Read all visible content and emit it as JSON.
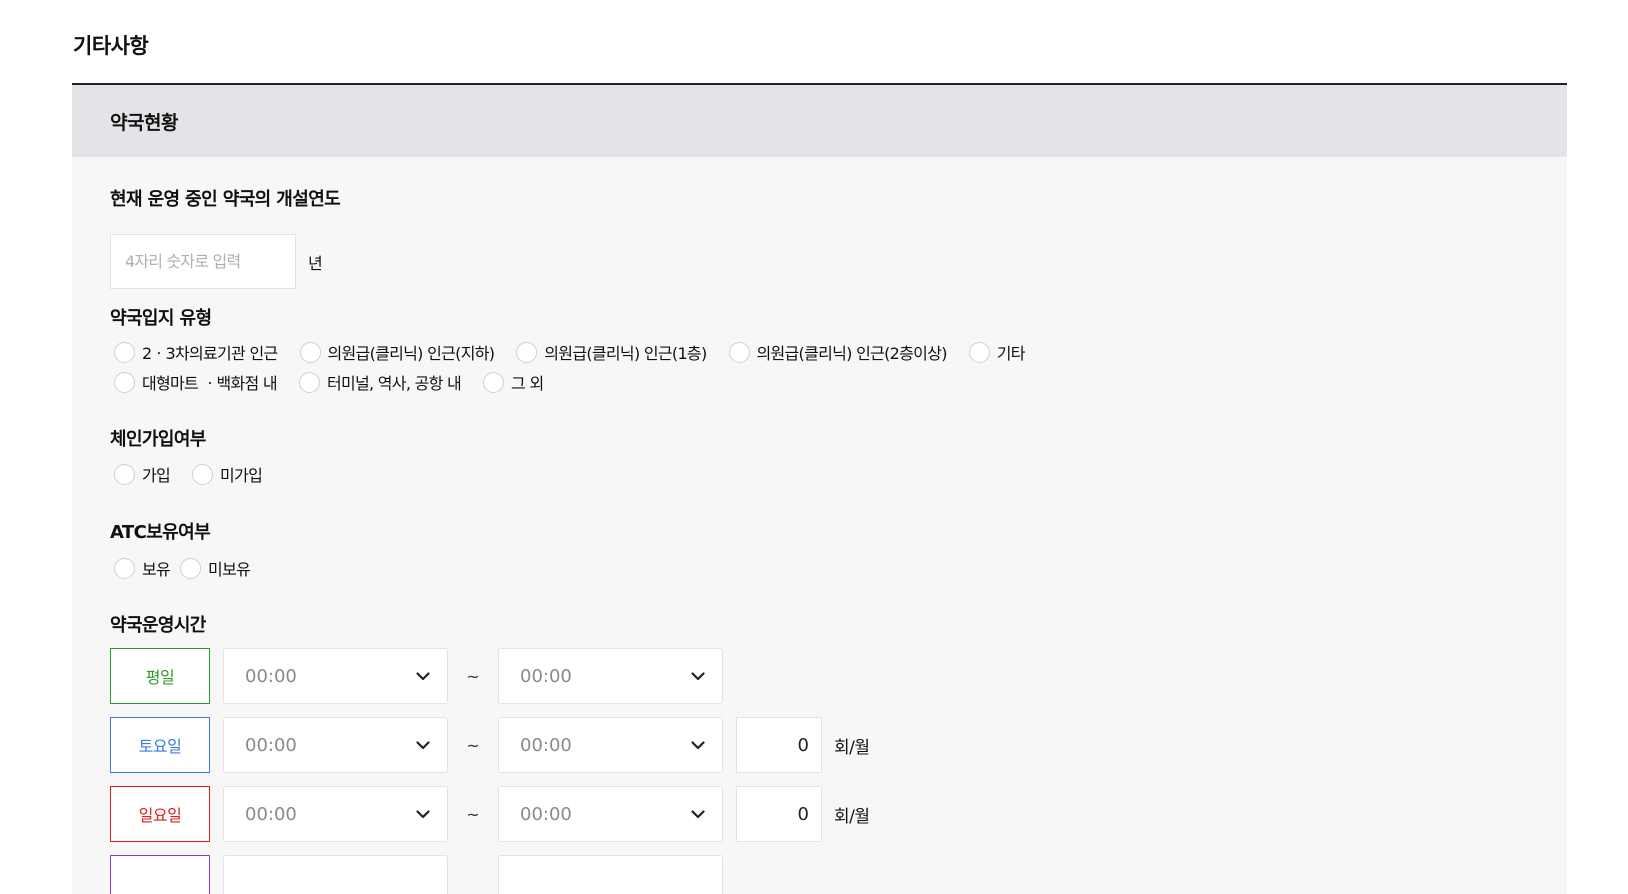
{
  "page": {
    "title": "기타사항"
  },
  "panel": {
    "title": "약국현황"
  },
  "opening_year": {
    "label": "현재 운영 중인 약국의 개설연도",
    "placeholder": "4자리 숫자로 입력",
    "value": "",
    "unit": "년"
  },
  "location_type": {
    "label": "약국입지 유형",
    "options_row1": [
      "2ㆍ3차의료기관 인근",
      "의원급(클리닉) 인근(지하)",
      "의원급(클리닉) 인근(1층)",
      "의원급(클리닉) 인근(2층이상)",
      "기타"
    ],
    "options_row2": [
      "대형마트 ㆍ백화점 내",
      "터미널, 역사, 공항 내",
      "그 외"
    ]
  },
  "chain": {
    "label": "체인가입여부",
    "options": [
      "가입",
      "미가입"
    ]
  },
  "atc": {
    "label": "ATC보유여부",
    "options": [
      "보유",
      "미보유"
    ]
  },
  "hours": {
    "label": "약국운영시간",
    "separator": "~",
    "rows": [
      {
        "day": "평일",
        "start": "00:00",
        "end": "00:00",
        "count": null,
        "unit": null,
        "color": "#2e9a2e"
      },
      {
        "day": "토요일",
        "start": "00:00",
        "end": "00:00",
        "count": "0",
        "unit": "회/월",
        "color": "#3b7ddd"
      },
      {
        "day": "일요일",
        "start": "00:00",
        "end": "00:00",
        "count": "0",
        "unit": "회/월",
        "color": "#e02020"
      },
      {
        "day": "",
        "start": "",
        "end": "",
        "count": null,
        "unit": null,
        "color": "#8b3ad8"
      }
    ]
  },
  "icons": {
    "select_arrow": "chevron-down-icon"
  }
}
